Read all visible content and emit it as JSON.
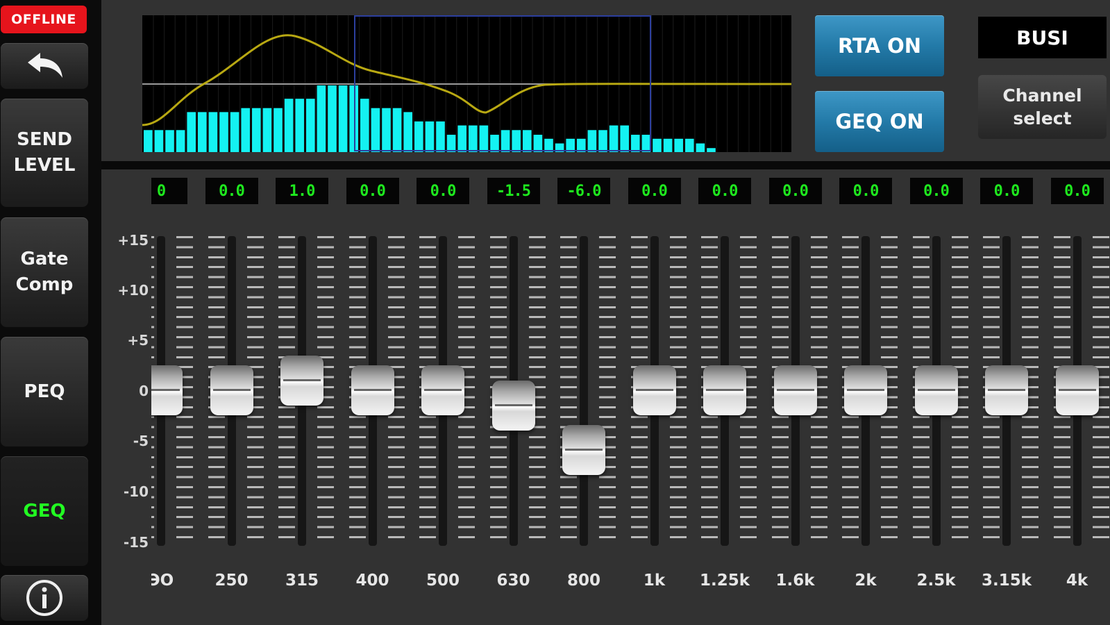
{
  "status": {
    "offline_label": "OFFLINE"
  },
  "sidebar": {
    "back_icon": "back-arrow-icon",
    "items": [
      {
        "label": "SEND\nLEVEL"
      },
      {
        "label": "Gate\nComp"
      },
      {
        "label": "PEQ"
      },
      {
        "label": "GEQ",
        "active": true
      }
    ],
    "info_icon": "info-icon"
  },
  "header": {
    "rta_button": "RTA ON",
    "geq_button": "GEQ ON",
    "bus_label": "BUSI",
    "channel_select": "Channel\nselect"
  },
  "colors": {
    "accent_blue": "#237aa8",
    "value_green": "#1ee81e",
    "rta_cyan": "#14f2f2",
    "curve_yellow": "#b8a812",
    "offline_red": "#e6141c"
  },
  "rta": {
    "bars": [
      0.33,
      0.33,
      0.33,
      0.33,
      0.6,
      0.6,
      0.6,
      0.6,
      0.6,
      0.66,
      0.66,
      0.66,
      0.66,
      0.8,
      0.8,
      0.8,
      1.0,
      1.0,
      1.0,
      1.0,
      0.8,
      0.66,
      0.66,
      0.66,
      0.6,
      0.46,
      0.46,
      0.46,
      0.26,
      0.4,
      0.4,
      0.4,
      0.26,
      0.33,
      0.33,
      0.33,
      0.26,
      0.2,
      0.13,
      0.2,
      0.2,
      0.33,
      0.33,
      0.4,
      0.4,
      0.26,
      0.26,
      0.2,
      0.2,
      0.2,
      0.2,
      0.13,
      0.06
    ]
  },
  "eq": {
    "scale": [
      "+15",
      "+10",
      "+5",
      "0",
      "-5",
      "-10",
      "-15"
    ],
    "bands": [
      {
        "freq": "ЭО",
        "value": "0",
        "gain": 0
      },
      {
        "freq": "250",
        "value": "0.0",
        "gain": 0
      },
      {
        "freq": "315",
        "value": "1.0",
        "gain": 1
      },
      {
        "freq": "400",
        "value": "0.0",
        "gain": 0
      },
      {
        "freq": "500",
        "value": "0.0",
        "gain": 0
      },
      {
        "freq": "630",
        "value": "-1.5",
        "gain": -1.5
      },
      {
        "freq": "800",
        "value": "-6.0",
        "gain": -6
      },
      {
        "freq": "1k",
        "value": "0.0",
        "gain": 0
      },
      {
        "freq": "1.25k",
        "value": "0.0",
        "gain": 0
      },
      {
        "freq": "1.6k",
        "value": "0.0",
        "gain": 0
      },
      {
        "freq": "2k",
        "value": "0.0",
        "gain": 0
      },
      {
        "freq": "2.5k",
        "value": "0.0",
        "gain": 0
      },
      {
        "freq": "3.15k",
        "value": "0.0",
        "gain": 0
      },
      {
        "freq": "4k",
        "value": "0.0",
        "gain": 0
      }
    ]
  }
}
